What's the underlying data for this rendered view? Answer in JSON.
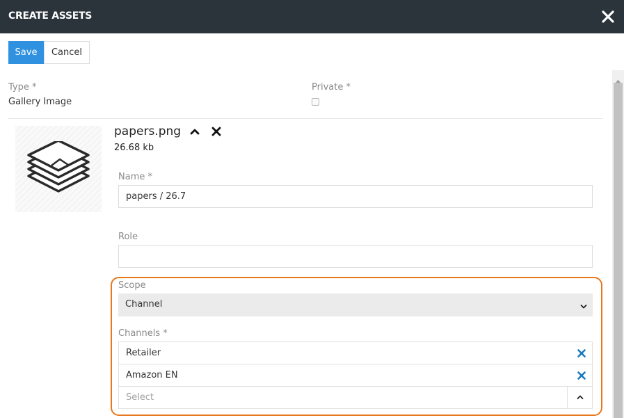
{
  "header": {
    "title": "CREATE ASSETS"
  },
  "toolbar": {
    "save_label": "Save",
    "cancel_label": "Cancel"
  },
  "form": {
    "type_label": "Type *",
    "type_value": "Gallery Image",
    "private_label": "Private *",
    "private_checked": false
  },
  "file": {
    "name": "papers.png",
    "size": "26.68 kb",
    "preview_icon": "papers-stack-icon"
  },
  "fields": {
    "name_label": "Name *",
    "name_value": "papers / 26.7",
    "role_label": "Role",
    "role_value": "",
    "scope_label": "Scope",
    "scope_value": "Channel",
    "channels_label": "Channels *",
    "channels": [
      "Retailer",
      "Amazon EN"
    ],
    "channels_placeholder": "Select"
  },
  "colors": {
    "header_bg": "#2b333b",
    "primary": "#2f91e0",
    "highlight_outline": "#e8771a",
    "remove_icon": "#1a7ac0"
  }
}
